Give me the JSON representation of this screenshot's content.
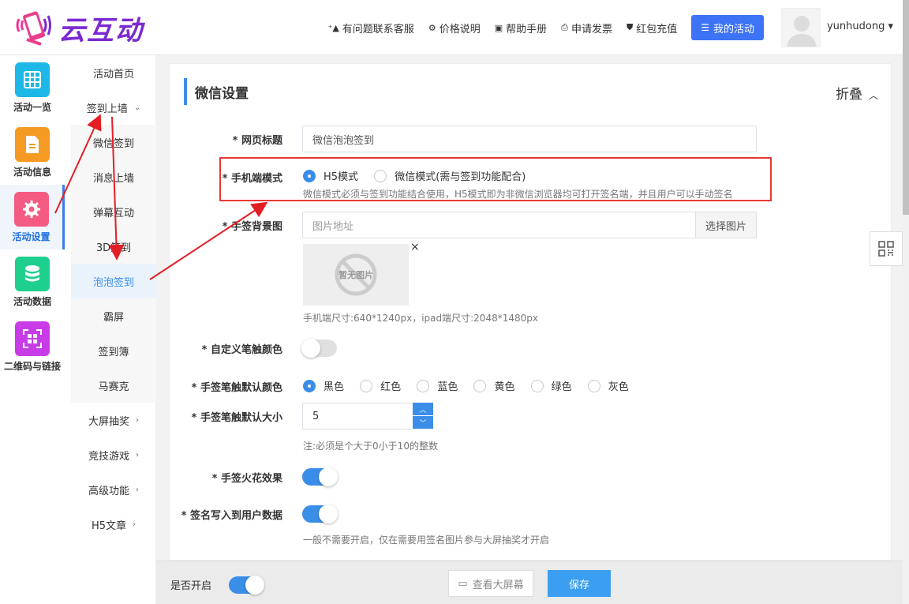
{
  "header": {
    "logo_text": "云互动",
    "nav": [
      {
        "label": "有问题联系客服",
        "icon": "⁺▲"
      },
      {
        "label": "价格说明",
        "icon": "⚙"
      },
      {
        "label": "帮助手册",
        "icon": "▣"
      },
      {
        "label": "申请发票",
        "icon": "⎙"
      },
      {
        "label": "红包充值",
        "icon": "⛊"
      }
    ],
    "my_activity": "我的活动",
    "username": "yunhudong ▾"
  },
  "side1": [
    {
      "label": "活动一览",
      "color": "#1eb8e8"
    },
    {
      "label": "活动信息",
      "color": "#f59a23"
    },
    {
      "label": "活动设置",
      "color": "#f45b82"
    },
    {
      "label": "活动数据",
      "color": "#1fcf8e"
    },
    {
      "label": "二维码与链接",
      "color": "#c83ce8"
    }
  ],
  "side2": [
    {
      "label": "活动首页",
      "chev": ""
    },
    {
      "label": "签到上墙",
      "chev": "⌄"
    },
    {
      "label": "微信签到",
      "chev": ""
    },
    {
      "label": "消息上墙",
      "chev": ""
    },
    {
      "label": "弹幕互动",
      "chev": ""
    },
    {
      "label": "3D签到",
      "chev": ""
    },
    {
      "label": "泡泡签到",
      "chev": ""
    },
    {
      "label": "霸屏",
      "chev": ""
    },
    {
      "label": "签到簿",
      "chev": ""
    },
    {
      "label": "马赛克",
      "chev": ""
    },
    {
      "label": "大屏抽奖",
      "chev": "›"
    },
    {
      "label": "竞技游戏",
      "chev": "›"
    },
    {
      "label": "高级功能",
      "chev": "›"
    },
    {
      "label": "H5文章",
      "chev": "›"
    }
  ],
  "panel": {
    "title": "微信设置",
    "collapse": "折叠",
    "fields": {
      "page_title_label": "* 网页标题",
      "page_title_value": "微信泡泡签到",
      "mobile_mode_label": "* 手机端模式",
      "mode_h5": "H5模式",
      "mode_wechat": "微信模式(需与签到功能配合)",
      "mode_help": "微信模式必须与签到功能结合使用，H5模式即为非微信浏览器均可打开签名端，并且用户可以手动签名",
      "bg_label": "* 手签背景图",
      "bg_placeholder": "图片地址",
      "choose_image": "选择图片",
      "no_image": "暂无图片",
      "size_help": "手机端尺寸:640*1240px，ipad端尺寸:2048*1480px",
      "custom_color_label": "* 自定义笔触颜色",
      "default_color_label": "* 手签笔触默认颜色",
      "colors": [
        "黑色",
        "红色",
        "蓝色",
        "黄色",
        "绿色",
        "灰色"
      ],
      "default_size_label": "* 手签笔触默认大小",
      "default_size_value": "5",
      "size_note": "注:必须是个大于0小于10的整数",
      "spark_label": "* 手签火花效果",
      "write_label": "* 签名写入到用户数据",
      "write_help": "一般不需要开启，仅在需要用签名图片参与大屏抽奖才开启"
    }
  },
  "footer": {
    "enable_label": "是否开启",
    "view_screen": "查看大屏幕",
    "save": "保存"
  }
}
